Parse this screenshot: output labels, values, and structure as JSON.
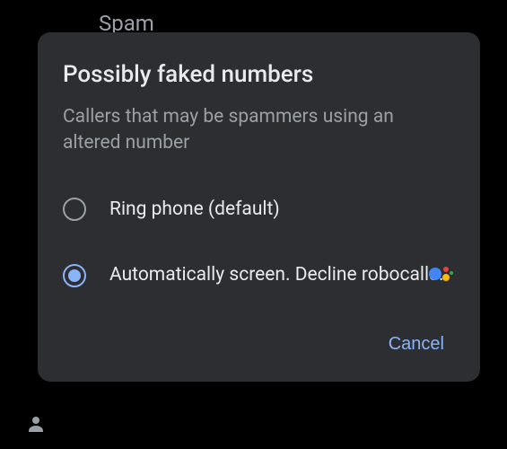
{
  "background": {
    "header_label": "Spam"
  },
  "dialog": {
    "title": "Possibly faked numbers",
    "subtitle": "Callers that may be spammers using an altered number",
    "options": [
      {
        "label": "Ring phone (default)",
        "selected": false
      },
      {
        "label": "Automatically screen. Decline robocalls.",
        "selected": true
      }
    ],
    "cancel_label": "Cancel"
  },
  "icons": {
    "assistant": "google-assistant-icon",
    "person": "person-icon"
  },
  "colors": {
    "accent": "#8ab4f8",
    "dialog_bg": "#2d2e31",
    "text_primary": "#e8eaed",
    "text_secondary": "#9aa0a6"
  }
}
